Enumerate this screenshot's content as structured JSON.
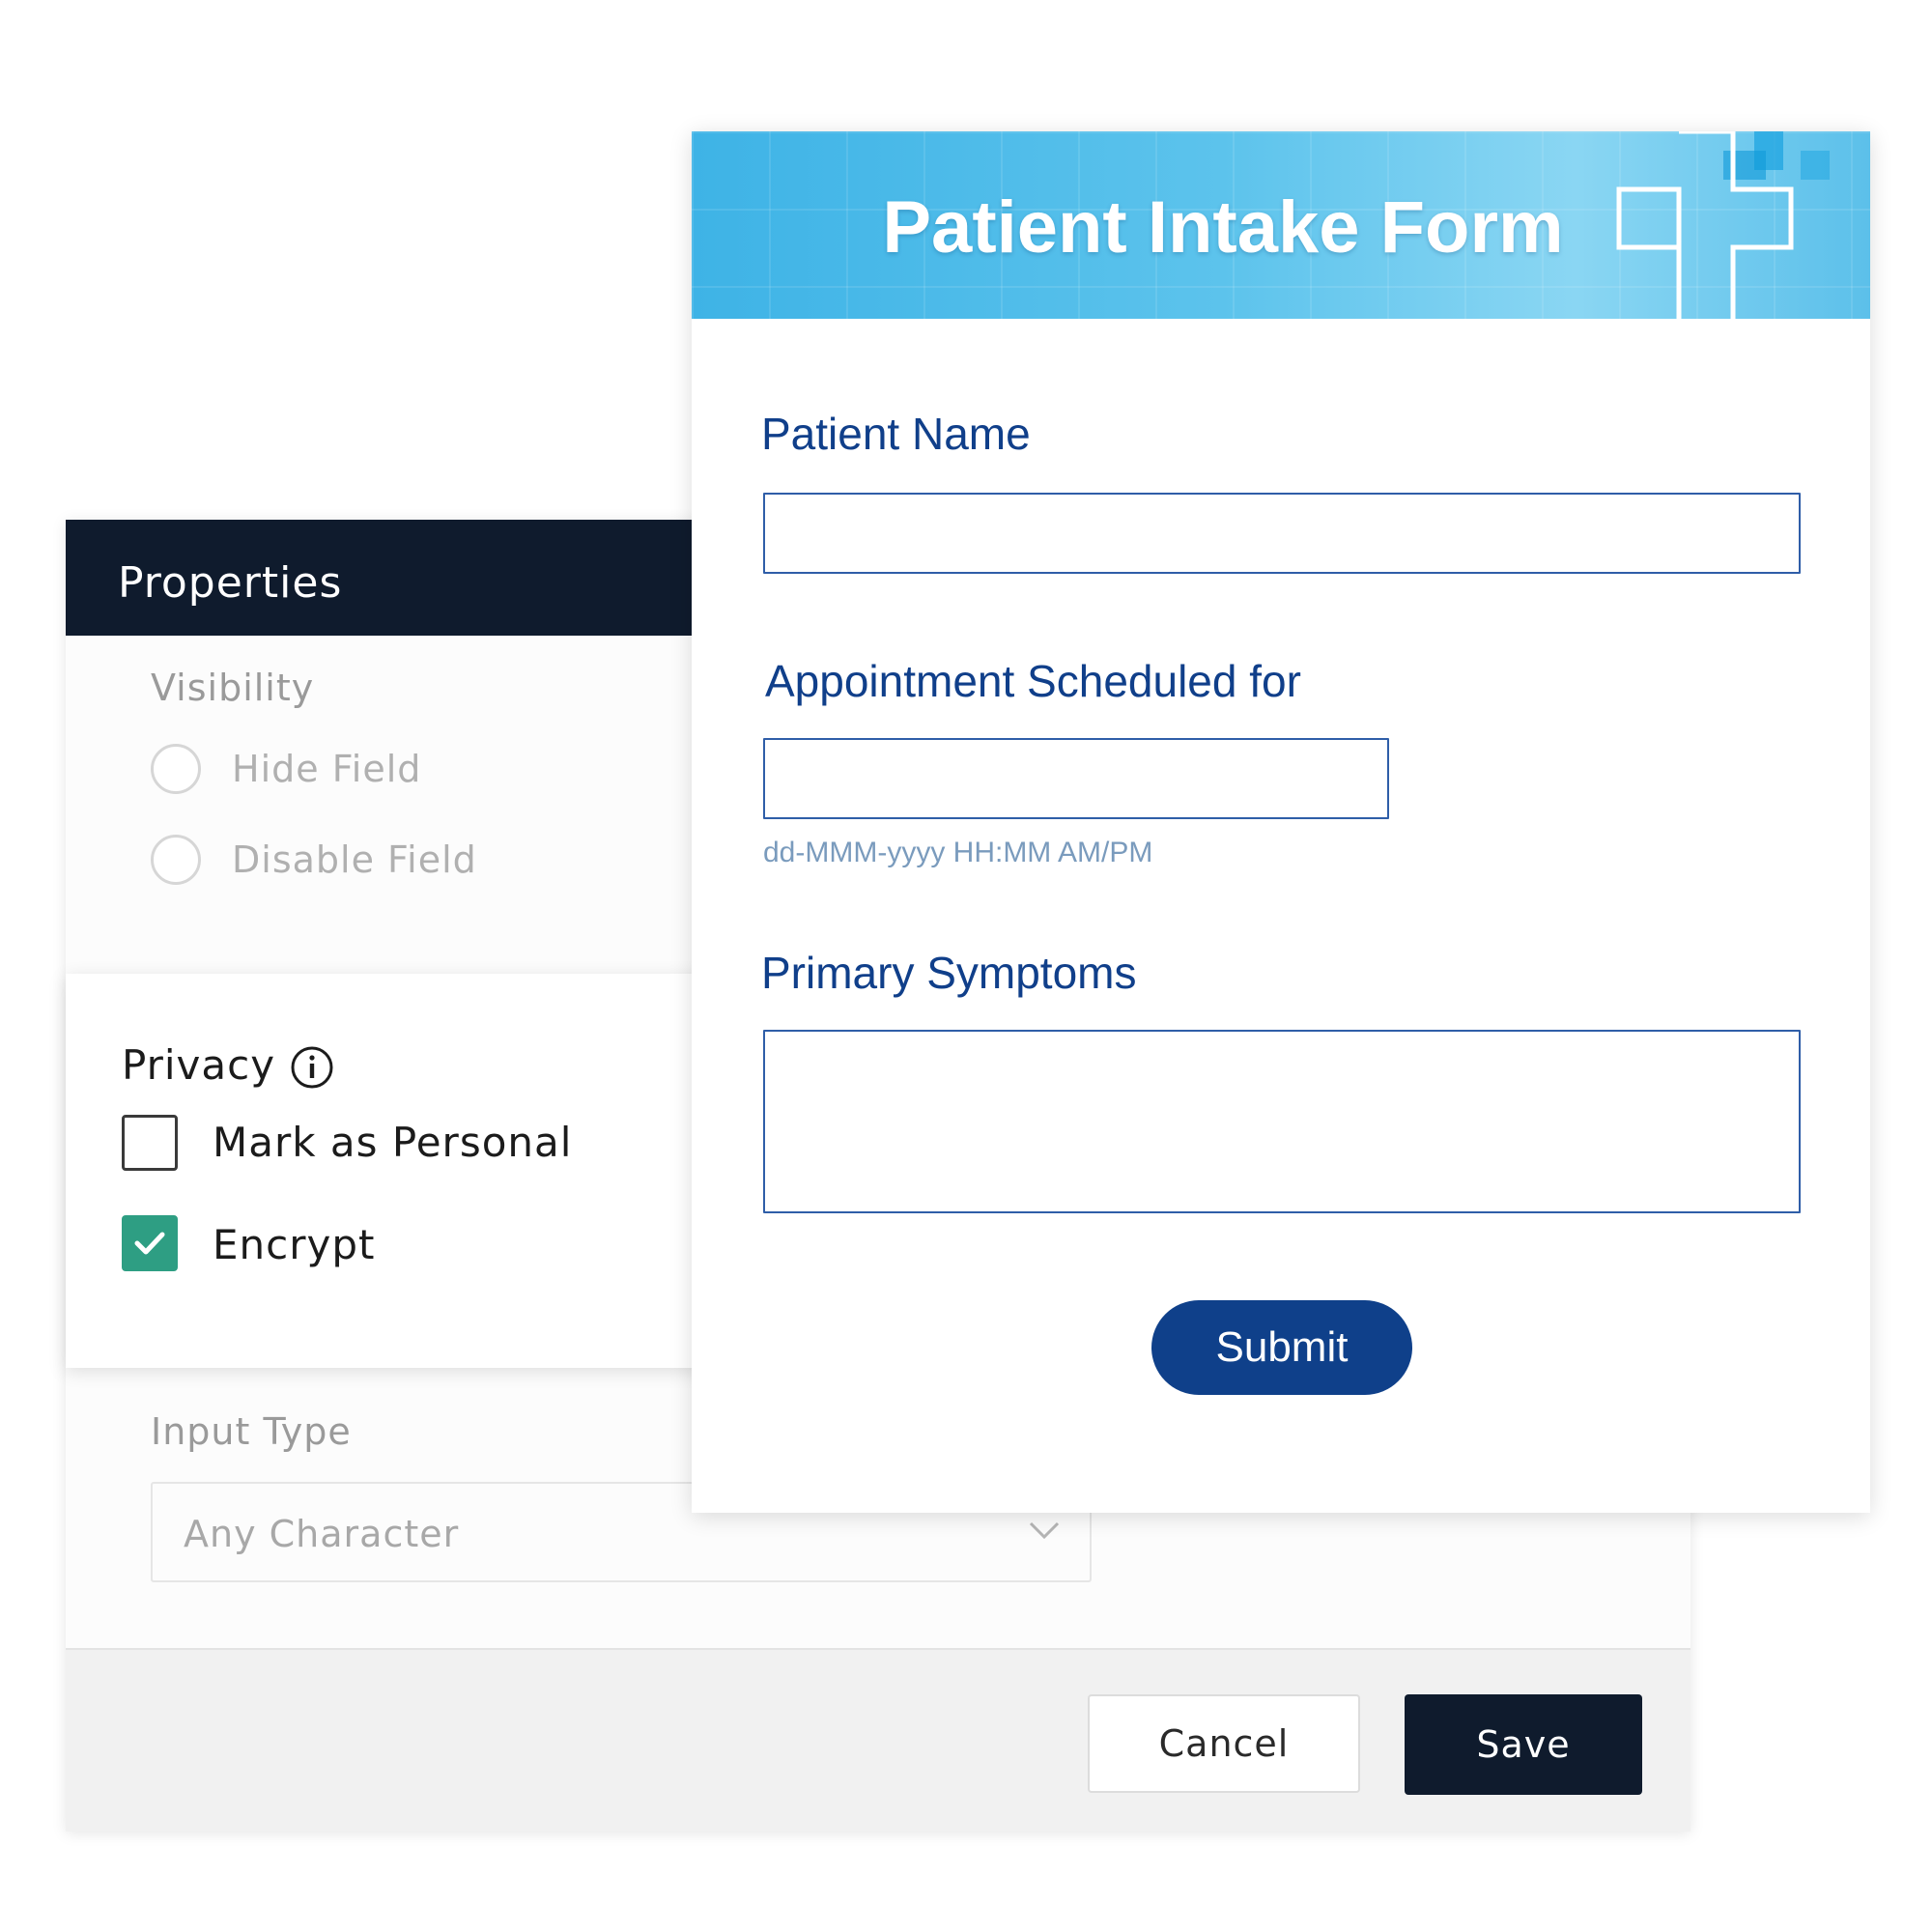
{
  "properties_panel": {
    "title": "Properties",
    "visibility": {
      "label": "Visibility",
      "options": [
        {
          "label": "Hide Field",
          "selected": false
        },
        {
          "label": "Disable Field",
          "selected": false
        }
      ]
    },
    "privacy": {
      "label": "Privacy",
      "info_icon": "info-icon",
      "options": [
        {
          "label": "Mark as Personal",
          "checked": false
        },
        {
          "label": "Encrypt",
          "checked": true
        }
      ]
    },
    "input_type": {
      "label": "Input Type",
      "selected_value": "Any Character"
    },
    "footer": {
      "cancel_label": "Cancel",
      "save_label": "Save"
    }
  },
  "intake_form": {
    "title": "Patient Intake Form",
    "fields": [
      {
        "label": "Patient Name",
        "value": ""
      },
      {
        "label": "Appointment Scheduled for",
        "value": "",
        "hint": "dd-MMM-yyyy HH:MM AM/PM"
      },
      {
        "label": "Primary Symptoms",
        "value": ""
      }
    ],
    "submit_label": "Submit"
  },
  "colors": {
    "panel_header": "#0f1b2d",
    "checkbox_checked": "#2e9e83",
    "form_label": "#103f8a",
    "submit_button": "#0f408a",
    "banner": "#4dbbe9"
  }
}
